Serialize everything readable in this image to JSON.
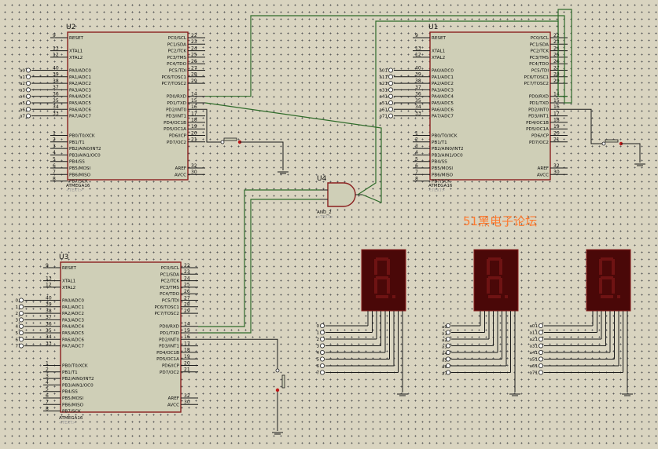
{
  "chips": [
    {
      "ref": "U2",
      "part": "ATMEGA16",
      "text": "<TEXT>"
    },
    {
      "ref": "U1",
      "part": "ATMEGA16",
      "text": "<TEXT>"
    },
    {
      "ref": "U3",
      "part": "ATMEGA16",
      "text": "<TEXT>"
    }
  ],
  "gate": {
    "ref": "U4",
    "part": "AND_2",
    "text": "<TEXT>"
  },
  "watermark": "51黑电子论坛",
  "pins_left_top": [
    {
      "num": "9",
      "label": "RESET"
    },
    {
      "num": "13",
      "label": "XTAL1"
    },
    {
      "num": "12",
      "label": "XTAL2"
    }
  ],
  "pins_left_pa": [
    {
      "num": "40",
      "label": "PA0/ADC0"
    },
    {
      "num": "39",
      "label": "PA1/ADC1"
    },
    {
      "num": "38",
      "label": "PA2/ADC2"
    },
    {
      "num": "37",
      "label": "PA3/ADC3"
    },
    {
      "num": "36",
      "label": "PA4/ADC4"
    },
    {
      "num": "35",
      "label": "PA5/ADC5"
    },
    {
      "num": "34",
      "label": "PA6/ADC6"
    },
    {
      "num": "33",
      "label": "PA7/ADC7"
    }
  ],
  "pins_left_pb": [
    {
      "num": "1",
      "label": "PB0/T0/XCK"
    },
    {
      "num": "2",
      "label": "PB1/T1"
    },
    {
      "num": "3",
      "label": "PB2/AIN0/INT2"
    },
    {
      "num": "4",
      "label": "PB3/AIN1/OC0"
    },
    {
      "num": "5",
      "label": "PB4/SS"
    },
    {
      "num": "6",
      "label": "PB5/MOSI"
    },
    {
      "num": "7",
      "label": "PB6/MISO"
    },
    {
      "num": "8",
      "label": "PB7/SCK"
    }
  ],
  "pins_right_pc": [
    {
      "num": "22",
      "label": "PC0/SCL"
    },
    {
      "num": "23",
      "label": "PC1/SDA"
    },
    {
      "num": "24",
      "label": "PC2/TCK"
    },
    {
      "num": "25",
      "label": "PC3/TMS"
    },
    {
      "num": "26",
      "label": "PC4/TDO"
    },
    {
      "num": "27",
      "label": "PC5/TDI"
    },
    {
      "num": "28",
      "label": "PC6/TOSC1"
    },
    {
      "num": "29",
      "label": "PC7/TOSC2"
    }
  ],
  "pins_right_pd": [
    {
      "num": "14",
      "label": "PD0/RXD"
    },
    {
      "num": "15",
      "label": "PD1/TXD"
    },
    {
      "num": "16",
      "label": "PD2/INT0"
    },
    {
      "num": "17",
      "label": "PD3/INT1"
    },
    {
      "num": "18",
      "label": "PD4/OC1B"
    },
    {
      "num": "19",
      "label": "PD5/OC1A"
    },
    {
      "num": "20",
      "label": "PD6/ICP"
    },
    {
      "num": "21",
      "label": "PD7/OC2"
    }
  ],
  "pins_right_bottom": [
    {
      "num": "32",
      "label": "AREF"
    },
    {
      "num": "30",
      "label": "AVCC"
    }
  ],
  "nets": {
    "u2_pa": [
      "a0",
      "a1",
      "a2",
      "a3",
      "a4",
      "a5",
      "a6",
      "a7"
    ],
    "u1_pa": [
      "a01",
      "a11",
      "a21",
      "a31",
      "a41",
      "a51",
      "a61",
      "a71"
    ],
    "u3_pa": [
      "0",
      "1",
      "2",
      "3",
      "4",
      "5",
      "6",
      "7"
    ],
    "disp1": [
      "0",
      "1",
      "2",
      "3",
      "4",
      "5",
      "6",
      "7"
    ],
    "disp2": [
      "a0",
      "a1",
      "a2",
      "a3",
      "a4",
      "a5",
      "a6",
      "a7"
    ],
    "disp3": [
      "a01",
      "a11",
      "a21",
      "a31",
      "a41",
      "a51",
      "a61",
      "a71"
    ]
  }
}
